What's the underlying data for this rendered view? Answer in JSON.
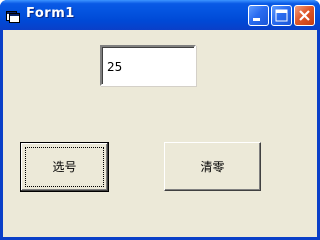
{
  "window": {
    "title": "Form1",
    "icon": "vb-form-icon",
    "controls": {
      "minimize": "minimize-icon",
      "maximize": "maximize-icon",
      "close": "close-icon"
    }
  },
  "form": {
    "textbox_value": "25",
    "select_button_label": "选号",
    "clear_button_label": "清零"
  },
  "colors": {
    "titlebar": "#0054e3",
    "client_background": "#ece9d8",
    "close_button": "#e0582a"
  }
}
